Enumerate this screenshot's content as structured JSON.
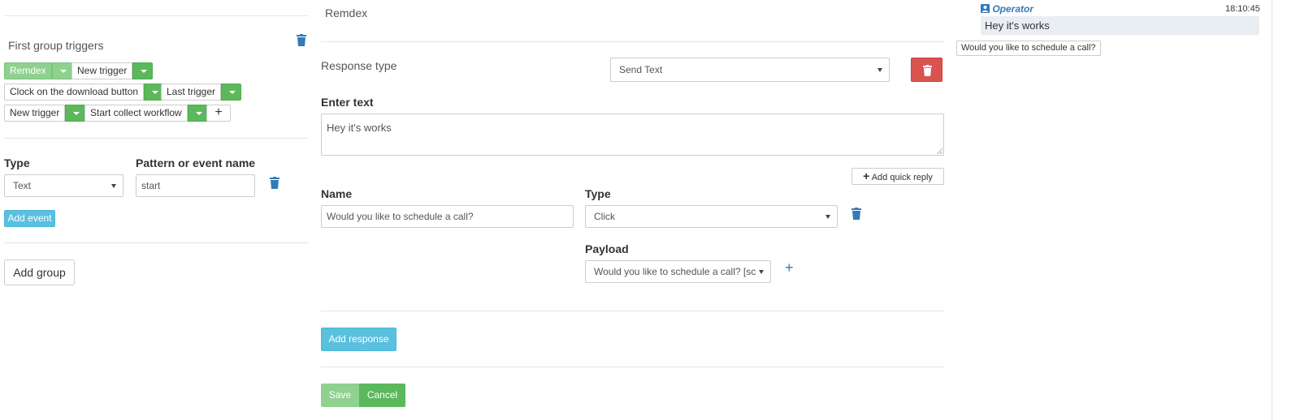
{
  "left": {
    "group_title": "First group triggers",
    "triggers": [
      {
        "label": "Remdex",
        "active": true
      },
      {
        "label": "New trigger",
        "active": false
      },
      {
        "label": "Clock on the download button",
        "active": false
      },
      {
        "label": "Last trigger",
        "active": false
      },
      {
        "label": "New trigger",
        "active": false
      },
      {
        "label": "Start collect workflow",
        "active": false
      }
    ],
    "add_trigger_label": "+",
    "type_label": "Type",
    "type_value": "Text",
    "pattern_label": "Pattern or event name",
    "pattern_value": "start",
    "add_event_label": "Add event",
    "add_group_label": "Add group"
  },
  "main": {
    "trigger_name": "Remdex",
    "response_type_label": "Response type",
    "response_type_value": "Send Text",
    "enter_text_label": "Enter text",
    "text_value": "Hey it's works",
    "add_quick_reply_label": "Add quick reply",
    "name_label": "Name",
    "name_value": "Would you like to schedule a call?",
    "type_label": "Type",
    "type_value": "Click",
    "payload_label": "Payload",
    "payload_value": "Would you like to schedule a call? [sc",
    "add_response_label": "Add response",
    "save_label": "Save",
    "cancel_label": "Cancel"
  },
  "chat": {
    "author": "Operator",
    "time": "18:10:45",
    "message": "Hey it's works",
    "quick_reply": "Would you like to schedule a call?"
  },
  "colors": {
    "primary": "#337ab7",
    "success": "#5cb85c",
    "info": "#5bc0de",
    "danger": "#d9534f"
  }
}
